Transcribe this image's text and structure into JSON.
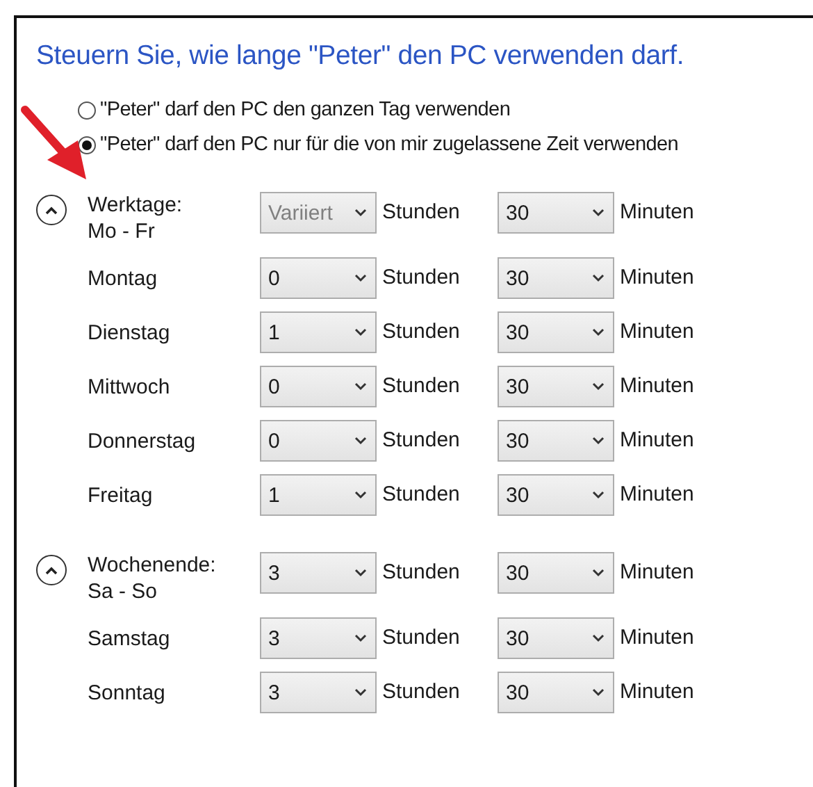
{
  "heading": "Steuern Sie, wie lange \"Peter\" den PC verwenden darf.",
  "options": [
    {
      "label": "\"Peter\" darf den PC den ganzen Tag verwenden",
      "selected": false
    },
    {
      "label": "\"Peter\" darf den PC nur für die von mir zugelassene Zeit verwenden",
      "selected": true
    }
  ],
  "groups": [
    {
      "title": "Werktage:",
      "range": "Mo - Fr",
      "expanded": true,
      "hours": {
        "value": "Variiert",
        "disabled": true
      },
      "hours_unit": "Stunden",
      "minutes": {
        "value": "30",
        "disabled": false
      },
      "minutes_unit": "Minuten",
      "days": [
        {
          "name": "Montag",
          "hours": "0",
          "hours_unit": "Stunden",
          "minutes": "30",
          "minutes_unit": "Minuten"
        },
        {
          "name": "Dienstag",
          "hours": "1",
          "hours_unit": "Stunden",
          "minutes": "30",
          "minutes_unit": "Minuten"
        },
        {
          "name": "Mittwoch",
          "hours": "0",
          "hours_unit": "Stunden",
          "minutes": "30",
          "minutes_unit": "Minuten"
        },
        {
          "name": "Donnerstag",
          "hours": "0",
          "hours_unit": "Stunden",
          "minutes": "30",
          "minutes_unit": "Minuten"
        },
        {
          "name": "Freitag",
          "hours": "1",
          "hours_unit": "Stunden",
          "minutes": "30",
          "minutes_unit": "Minuten"
        }
      ]
    },
    {
      "title": "Wochenende:",
      "range": "Sa - So",
      "expanded": true,
      "hours": {
        "value": "3",
        "disabled": false
      },
      "hours_unit": "Stunden",
      "minutes": {
        "value": "30",
        "disabled": false
      },
      "minutes_unit": "Minuten",
      "days": [
        {
          "name": "Samstag",
          "hours": "3",
          "hours_unit": "Stunden",
          "minutes": "30",
          "minutes_unit": "Minuten"
        },
        {
          "name": "Sonntag",
          "hours": "3",
          "hours_unit": "Stunden",
          "minutes": "30",
          "minutes_unit": "Minuten"
        }
      ]
    }
  ]
}
